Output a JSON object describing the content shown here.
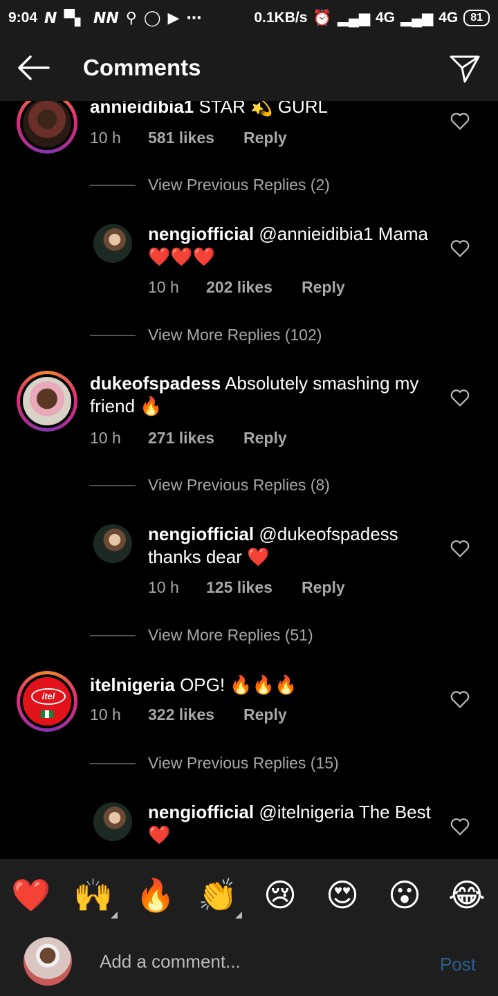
{
  "status": {
    "time": "9:04",
    "network_speed": "0.1KB/s",
    "net1": "4G",
    "net2": "4G",
    "battery": "81"
  },
  "header": {
    "title": "Comments"
  },
  "comments": [
    {
      "username": "annieidibia1",
      "text_before": "STAR",
      "emoji": "💫",
      "text_after": "GURL",
      "time": "10 h",
      "likes": "581 likes",
      "reply": "Reply",
      "view_prev": "View Previous Replies (2)",
      "reply_item": {
        "username": "nengiofficial",
        "mention": "@annieidibia1",
        "text": "Mama",
        "emoji": "❤️❤️❤️",
        "time": "10 h",
        "likes": "202 likes",
        "reply": "Reply"
      },
      "view_more": "View More Replies (102)"
    },
    {
      "username": "dukeofspadess",
      "text": "Absolutely smashing my friend",
      "emoji": "🔥",
      "time": "10 h",
      "likes": "271 likes",
      "reply": "Reply",
      "view_prev": "View Previous Replies (8)",
      "reply_item": {
        "username": "nengiofficial",
        "mention": "@dukeofspadess",
        "text": "thanks dear",
        "emoji": "❤️",
        "time": "10 h",
        "likes": "125 likes",
        "reply": "Reply"
      },
      "view_more": "View More Replies (51)"
    },
    {
      "username": "itelnigeria",
      "text": "OPG!",
      "emoji": "🔥🔥🔥",
      "time": "10 h",
      "likes": "322 likes",
      "reply": "Reply",
      "view_prev": "View Previous Replies (15)",
      "reply_item": {
        "username": "nengiofficial",
        "mention": "@itelnigeria",
        "text": "The Best",
        "emoji": "❤️"
      }
    }
  ],
  "emoji_bar": [
    "❤️",
    "🙌",
    "🔥",
    "👏",
    "😢",
    "😍",
    "😮",
    "😂"
  ],
  "composer": {
    "placeholder": "Add a comment...",
    "post": "Post"
  }
}
